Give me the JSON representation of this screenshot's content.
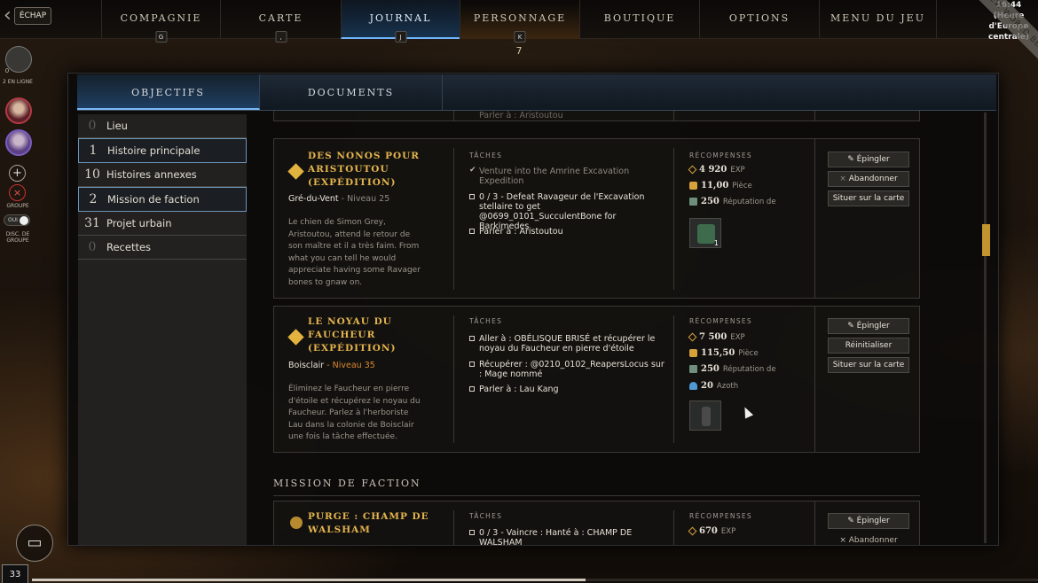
{
  "escape_label": "ÉCHAP",
  "nav": [
    {
      "label": "COMPAGNIE",
      "key": "G"
    },
    {
      "label": "CARTE",
      "key": ","
    },
    {
      "label": "JOURNAL",
      "key": "J"
    },
    {
      "label": "PERSONNAGE",
      "key": "K",
      "count": "7"
    },
    {
      "label": "BOUTIQUE",
      "key": ""
    },
    {
      "label": "OPTIONS",
      "key": ""
    },
    {
      "label": "MENU DU JEU",
      "key": ""
    }
  ],
  "clock": {
    "time": "16:44",
    "tz1": "(Heure",
    "tz2": "d'Europe",
    "tz3": "centrale)"
  },
  "ribbon": "NEW WORLD BETA",
  "social": {
    "online_count": "0",
    "online_label": "2 EN LIGNE",
    "group_label": "GROUPE",
    "toggle": "OUI",
    "disc_label1": "DISC. DE",
    "disc_label2": "GROUPE"
  },
  "level": "33",
  "xp_progress": 0.55,
  "subtabs": [
    "OBJECTIFS",
    "DOCUMENTS"
  ],
  "categories": [
    {
      "count": "0",
      "label": "Lieu"
    },
    {
      "count": "1",
      "label": "Histoire principale"
    },
    {
      "count": "10",
      "label": "Histoires annexes"
    },
    {
      "count": "2",
      "label": "Mission de faction"
    },
    {
      "count": "31",
      "label": "Projet urbain"
    },
    {
      "count": "0",
      "label": "Recettes"
    }
  ],
  "partial_top": "Parler à : Aristoutou",
  "quest_headers": {
    "tasks": "TÂCHES",
    "rewards": "RÉCOMPENSES"
  },
  "quests": [
    {
      "title": "DES NONOS POUR ARISTOUTOU (EXPÉDITION)",
      "location": "Gré-du-Vent",
      "level": "- Niveau 25",
      "description": "Le chien de Simon Grey, Aristoutou, attend le retour de son maître et il a très faim. From what you can tell he would appreciate having some Ravager bones to gnaw on.",
      "tasks": [
        "Venture into the Amrine Excavation Expedition",
        "0 / 3 - Defeat Ravageur de l'Excavation stellaire to get @0699_0101_SucculentBone for Barkimedes",
        "Parler à : Aristoutou"
      ],
      "rewards": [
        {
          "icon": "exp-icon",
          "value": "4 920",
          "unit": "EXP"
        },
        {
          "icon": "coin-icon",
          "value": "11,00",
          "unit": "Pièce"
        },
        {
          "icon": "reputation-icon",
          "value": "250",
          "unit": "Réputation de"
        }
      ],
      "item_count": "1",
      "buttons": [
        "Épingler",
        "Abandonner",
        "Situer sur la carte"
      ]
    },
    {
      "title": "LE NOYAU DU FAUCHEUR (EXPÉDITION)",
      "location": "Boisclair",
      "level": "- Niveau 35",
      "description": "Éliminez le Faucheur en pierre d'étoile et récupérez le noyau du Faucheur. Parlez à l'herboriste Lau dans la colonie de Boisclair une fois la tâche effectuée.",
      "tasks": [
        "Aller à : OBÉLISQUE BRISÉ et récupérer le noyau du Faucheur en pierre d'étoile",
        "Récupérer : @0210_0102_ReapersLocus sur : Mage nommé",
        "Parler à : Lau Kang"
      ],
      "rewards": [
        {
          "icon": "exp-icon",
          "value": "7 500",
          "unit": "EXP"
        },
        {
          "icon": "coin-icon",
          "value": "115,50",
          "unit": "Pièce"
        },
        {
          "icon": "reputation-icon",
          "value": "250",
          "unit": "Réputation de"
        },
        {
          "icon": "azoth-icon",
          "value": "20",
          "unit": "Azoth"
        }
      ],
      "buttons": [
        "Épingler",
        "Réinitialiser",
        "Situer sur la carte"
      ]
    },
    {
      "title": "PURGE : CHAMP DE WALSHAM",
      "task": "0 / 3 - Vaincre : Hanté à : CHAMP DE WALSHAM",
      "reward": {
        "value": "670",
        "unit": "EXP"
      },
      "buttons": [
        "Épingler",
        "Abandonner"
      ]
    }
  ],
  "section_faction": "MISSION DE FACTION"
}
